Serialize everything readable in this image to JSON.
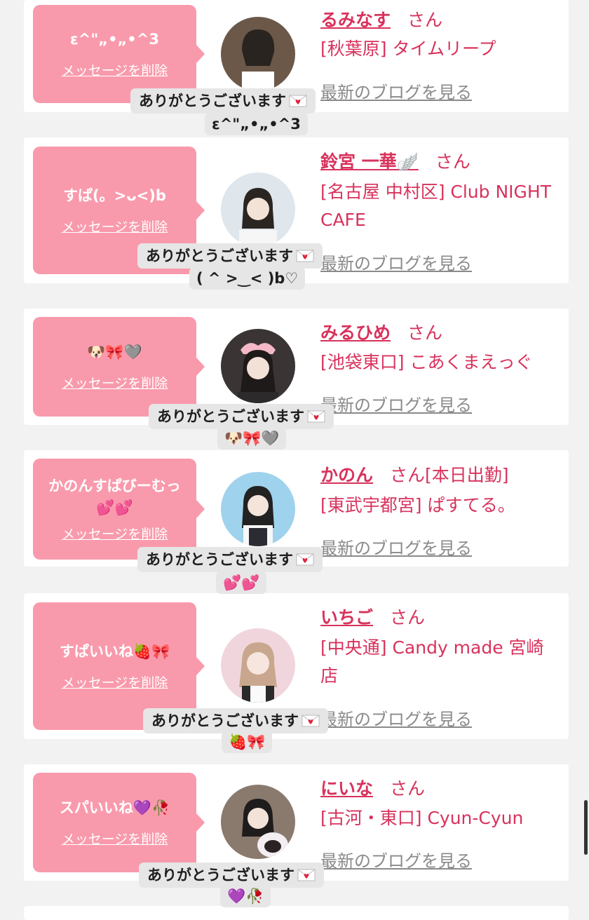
{
  "cards": [
    {
      "message": "ε^\"„•„•^3",
      "delete_label": "メッセージを削除",
      "name": "るみなす",
      "honorific": "さん",
      "extra": "",
      "shop": "[秋葉原] タイムリープ",
      "blog": "最新のブログを見る",
      "toast": "ありがとうございます",
      "toast_reply": "ε^\"„•„•^3"
    },
    {
      "message": "すぱ(。>ᴗ<)b",
      "delete_label": "メッセージを削除",
      "name": "鈴宮 一華🪽",
      "honorific": "さん",
      "extra": "",
      "shop": "[名古屋 中村区] Club NIGHT CAFE",
      "blog": "最新のブログを見る",
      "toast": "ありがとうございます",
      "toast_reply": "( ^ >‿< )b♡"
    },
    {
      "message": "🐶🎀🩶",
      "delete_label": "メッセージを削除",
      "name": "みるひめ",
      "honorific": "さん",
      "extra": "",
      "shop": "[池袋東口] こあくまえっぐ",
      "blog": "最新のブログを見る",
      "toast": "ありがとうございます",
      "toast_reply": "🐶🎀🩶"
    },
    {
      "message": "かのんすぱびーむっ💕💕",
      "delete_label": "メッセージを削除",
      "name": "かのん",
      "honorific": "さん",
      "extra": "[本日出勤]",
      "shop": "[東武宇都宮] ぱすてる。",
      "blog": "最新のブログを見る",
      "toast": "ありがとうございます",
      "toast_reply": "💕💕"
    },
    {
      "message": "すぱいいね🍓🎀",
      "delete_label": "メッセージを削除",
      "name": "いちご",
      "honorific": "さん",
      "extra": "",
      "shop": "[中央通] Candy made 宮崎店",
      "blog": "最新のブログを見る",
      "toast": "ありがとうございます",
      "toast_reply": "🍓🎀"
    },
    {
      "message": "スパいいね💜🥀",
      "delete_label": "メッセージを削除",
      "name": "にいな",
      "honorific": "さん",
      "extra": "",
      "shop": "[古河・東口] Cyun-Cyun",
      "blog": "最新のブログを見る",
      "toast": "ありがとうございます",
      "toast_reply": "💜🥀"
    }
  ],
  "colors": {
    "bubble": "#f99aac",
    "name": "#d8325c",
    "background": "#f2f2f2",
    "toast": "#e6e6e6"
  },
  "icons": {
    "toast": "love-letter-icon",
    "avatar": "profile-photo"
  }
}
